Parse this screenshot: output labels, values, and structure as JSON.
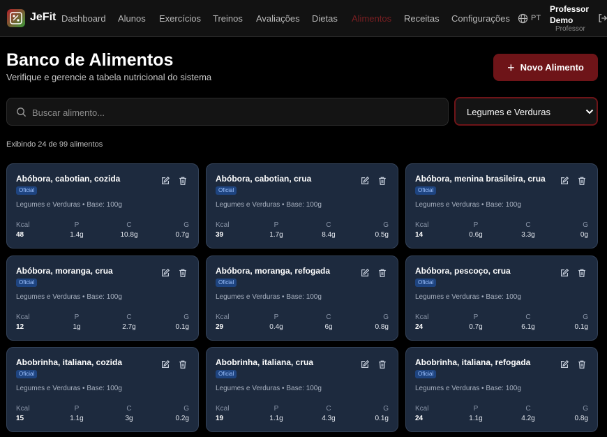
{
  "nav": {
    "brand": "JeFit",
    "items": [
      "Dashboard",
      "Alunos",
      "Exercícios",
      "Treinos",
      "Avaliações",
      "Dietas",
      "Alimentos",
      "Receitas",
      "Configurações"
    ],
    "active": "Alimentos",
    "language": "PT",
    "user_name": "Professor Demo",
    "user_role": "Professor",
    "accent_color": "#7a1f22"
  },
  "header": {
    "title": "Banco de Alimentos",
    "subtitle": "Verifique e gerencie a tabela nutricional do sistema",
    "new_button": "Novo Alimento"
  },
  "filters": {
    "search_placeholder": "Buscar alimento...",
    "search_value": "",
    "category": "Legumes e Verduras"
  },
  "count_text": "Exibindo 24 de 99 alimentos",
  "macro_labels": {
    "kcal": "Kcal",
    "p": "P",
    "c": "C",
    "g": "G"
  },
  "foods": [
    {
      "name": "Abóbora, cabotian, cozida",
      "badge": "Oficial",
      "meta": "Legumes e Verduras • Base: 100g",
      "kcal": "48",
      "p": "1.4g",
      "c": "10.8g",
      "g": "0.7g"
    },
    {
      "name": "Abóbora, cabotian, crua",
      "badge": "Oficial",
      "meta": "Legumes e Verduras • Base: 100g",
      "kcal": "39",
      "p": "1.7g",
      "c": "8.4g",
      "g": "0.5g"
    },
    {
      "name": "Abóbora, menina brasileira, crua",
      "badge": "Oficial",
      "meta": "Legumes e Verduras • Base: 100g",
      "kcal": "14",
      "p": "0.6g",
      "c": "3.3g",
      "g": "0g"
    },
    {
      "name": "Abóbora, moranga, crua",
      "badge": "Oficial",
      "meta": "Legumes e Verduras • Base: 100g",
      "kcal": "12",
      "p": "1g",
      "c": "2.7g",
      "g": "0.1g"
    },
    {
      "name": "Abóbora, moranga, refogada",
      "badge": "Oficial",
      "meta": "Legumes e Verduras • Base: 100g",
      "kcal": "29",
      "p": "0.4g",
      "c": "6g",
      "g": "0.8g"
    },
    {
      "name": "Abóbora, pescoço, crua",
      "badge": "Oficial",
      "meta": "Legumes e Verduras • Base: 100g",
      "kcal": "24",
      "p": "0.7g",
      "c": "6.1g",
      "g": "0.1g"
    },
    {
      "name": "Abobrinha, italiana, cozida",
      "badge": "Oficial",
      "meta": "Legumes e Verduras • Base: 100g",
      "kcal": "15",
      "p": "1.1g",
      "c": "3g",
      "g": "0.2g"
    },
    {
      "name": "Abobrinha, italiana, crua",
      "badge": "Oficial",
      "meta": "Legumes e Verduras • Base: 100g",
      "kcal": "19",
      "p": "1.1g",
      "c": "4.3g",
      "g": "0.1g"
    },
    {
      "name": "Abobrinha, italiana, refogada",
      "badge": "Oficial",
      "meta": "Legumes e Verduras • Base: 100g",
      "kcal": "24",
      "p": "1.1g",
      "c": "4.2g",
      "g": "0.8g"
    }
  ]
}
